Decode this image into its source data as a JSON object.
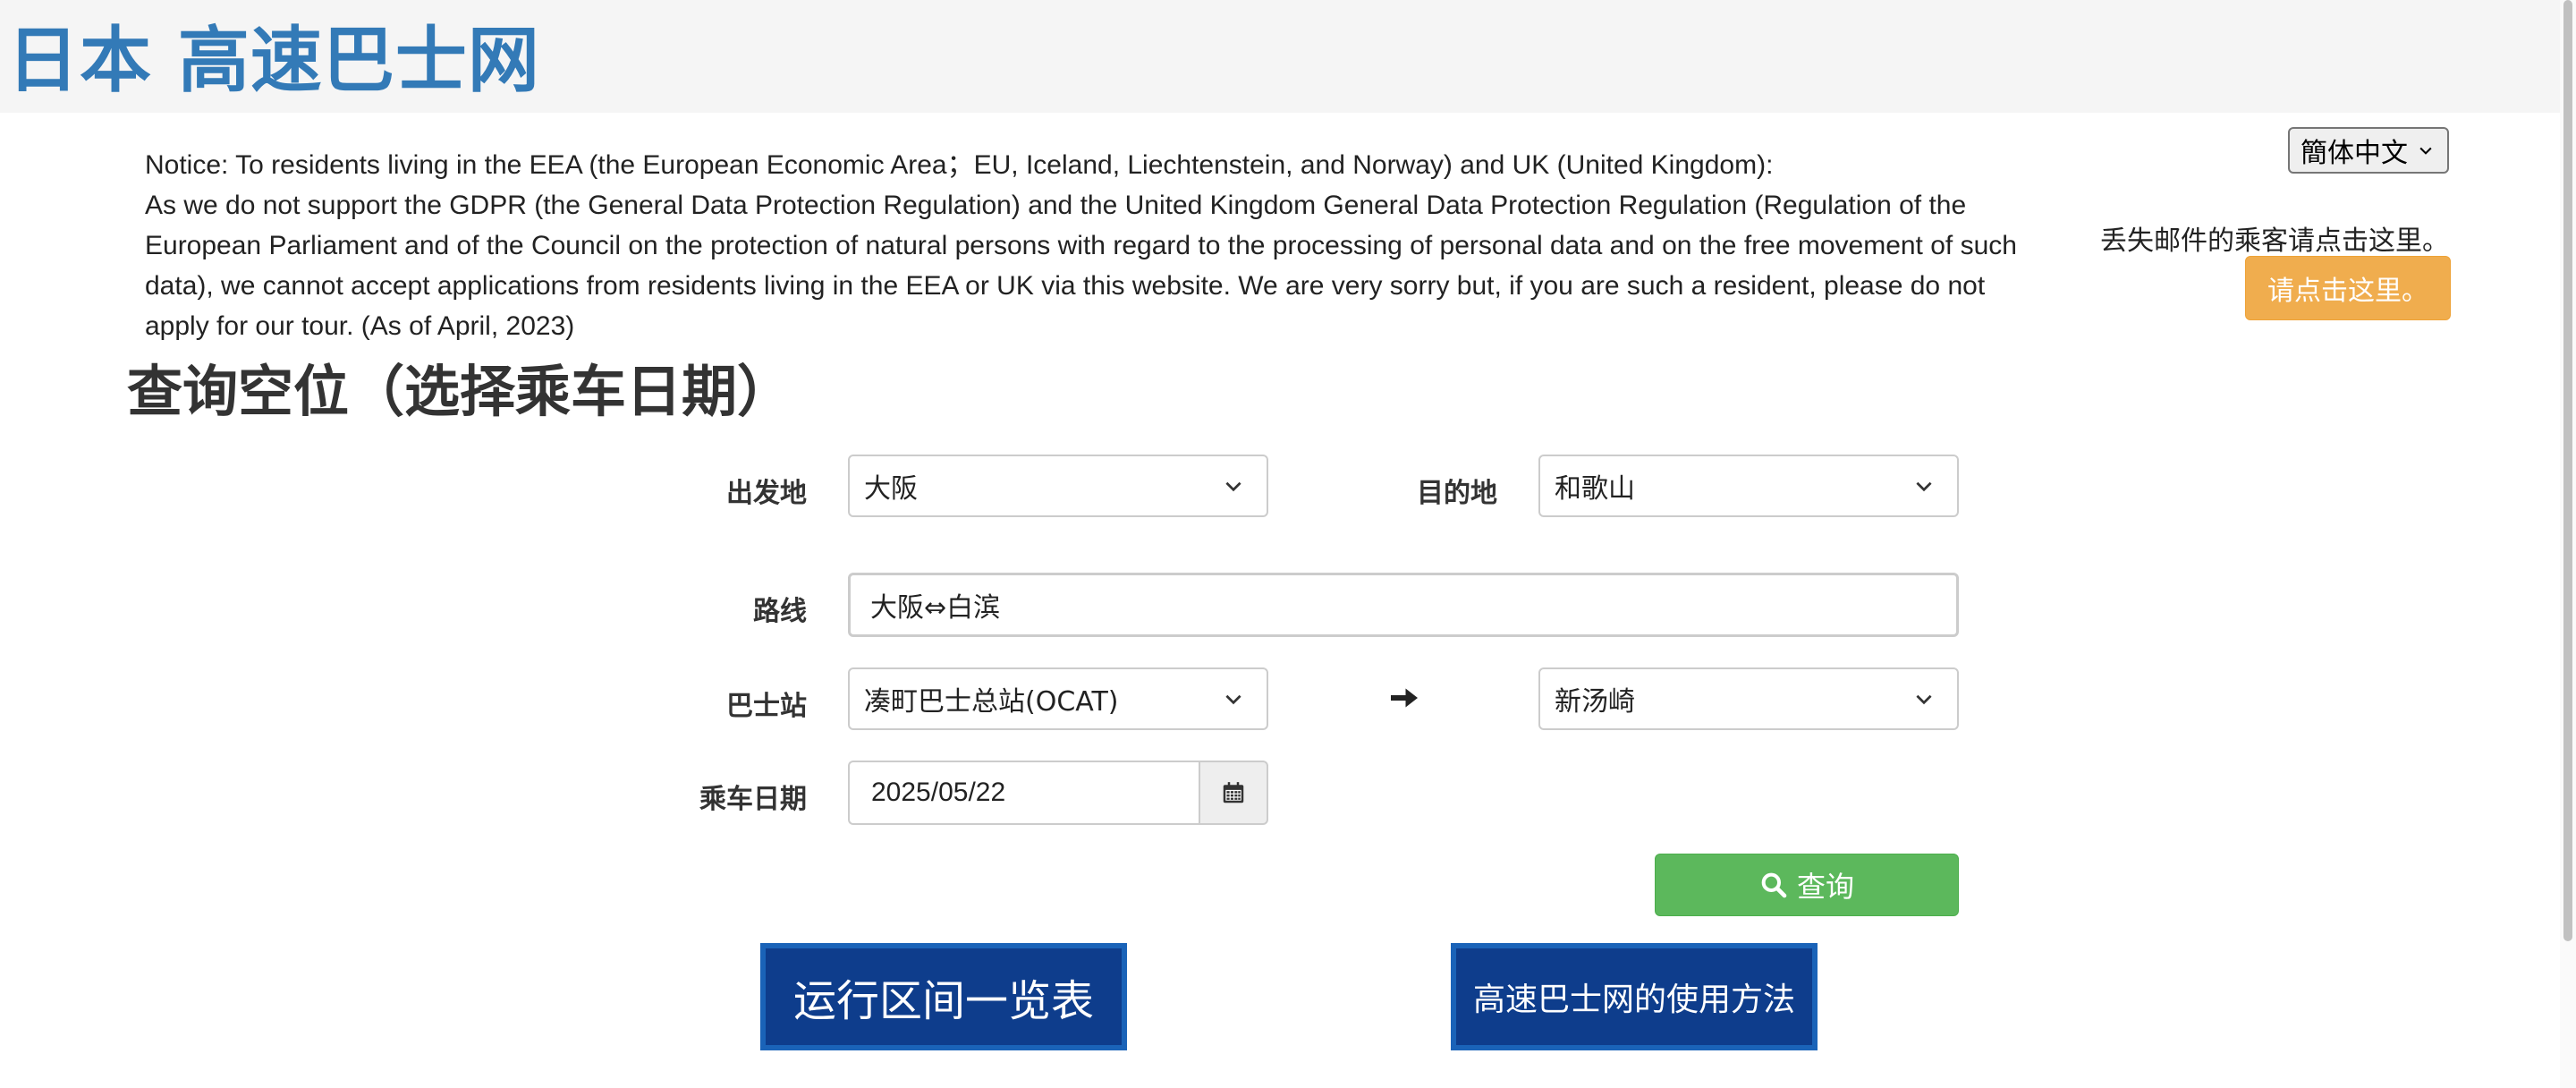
{
  "header": {
    "site_title": "日本 高速巴士网"
  },
  "language": {
    "selected": "簡体中文"
  },
  "lost_mail": {
    "text": "丢失邮件的乘客请点击这里。",
    "button_label": "请点击这里。"
  },
  "notice": {
    "line1": "Notice: To residents living in the EEA (the European Economic Area；EU, Iceland, Liechtenstein, and Norway) and UK (United Kingdom):",
    "line2": "As we do not support the GDPR (the General Data Protection Regulation) and the United Kingdom General Data Protection Regulation (Regulation of the European Parliament and of the Council on the protection of natural persons with regard to the processing of personal data and on the free movement of such data), we cannot accept applications from residents living in the EEA or UK via this website.  We are very sorry but, if you are such a resident, please do not apply for our tour. (As of April, 2023)"
  },
  "search_form": {
    "title": "查询空位（选择乘车日期）",
    "departure_label": "出发地",
    "departure_value": "大阪",
    "destination_label": "目的地",
    "destination_value": "和歌山",
    "route_label": "路线",
    "route_value": "大阪⇔白滨",
    "stop_label": "巴士站",
    "from_stop_value": "凑町巴士总站(OCAT)",
    "to_stop_value": "新汤崎",
    "date_label": "乘车日期",
    "date_value": "2025/05/22",
    "search_button": "查询"
  },
  "banners": {
    "route_list": "运行区间一览表",
    "how_to_use": "高速巴士网的使用方法"
  },
  "colors": {
    "brand_blue": "#337ab7",
    "warning": "#f0ad4e",
    "success": "#5cb85c",
    "banner_navy": "#0e3d8c"
  }
}
